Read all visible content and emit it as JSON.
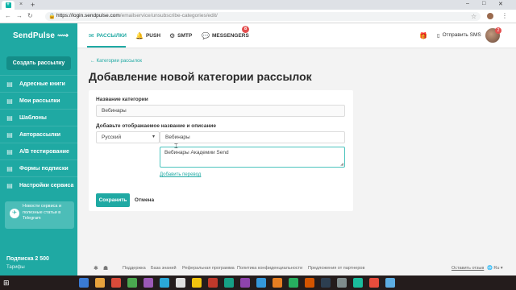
{
  "browser": {
    "tab_icon": "sendpulse-favicon",
    "close_glyph": "×",
    "new_tab_glyph": "+",
    "url_host": "https://login.sendpulse.com",
    "url_path": "/emailservice/unsubscribe-categories/edit/"
  },
  "app": {
    "logo": "SendPulse",
    "logo_mark": "⟿",
    "accent": "#1fa9a3"
  },
  "topnav": {
    "items": [
      {
        "label": "РАССЫЛКИ",
        "icon": "envelope-icon",
        "glyph": "✉",
        "active": true
      },
      {
        "label": "PUSH",
        "icon": "bell-icon",
        "glyph": "🔔",
        "active": false
      },
      {
        "label": "SMTP",
        "icon": "gear-icon",
        "glyph": "⚙",
        "active": false
      },
      {
        "label": "MESSENGERS",
        "icon": "chat-icon",
        "glyph": "💬",
        "active": false
      }
    ],
    "messengers_badge": "8",
    "send_sms": "Отправить SMS",
    "avatar_badge": "2"
  },
  "sidebar": {
    "create_button": "Создать рассылку",
    "items": [
      {
        "label": "Адресные книги",
        "icon": "book-icon",
        "glyph": "▤"
      },
      {
        "label": "Мои рассылки",
        "icon": "mail-list-icon",
        "glyph": "▤"
      },
      {
        "label": "Шаблоны",
        "icon": "template-icon",
        "glyph": "▤"
      },
      {
        "label": "Авторассылки",
        "icon": "automation-icon",
        "glyph": "▤"
      },
      {
        "label": "A/B тестирование",
        "icon": "ab-test-icon",
        "glyph": "▤"
      },
      {
        "label": "Формы подписки",
        "icon": "form-icon",
        "glyph": "▤"
      },
      {
        "label": "Настройки сервиса",
        "icon": "settings-icon",
        "glyph": "▤"
      }
    ],
    "telegram_text": "Новости сервиса и полезные статьи в Telegram",
    "telegram_glyph": "✈",
    "plan": "Подписка 2 500",
    "plan_sub": "Тарифы"
  },
  "main": {
    "breadcrumb": "← Категории рассылок",
    "title": "Добавление новой категории рассылок",
    "category_label": "Название категории",
    "category_value": "Вебинары",
    "display_label": "Добавьте отображаемое название и описание",
    "language_value": "Русский",
    "display_name_value": "Вебинары",
    "description_value": "Вебинары Академии Send",
    "add_translation": "Добавить перевод",
    "save_button": "Сохранить",
    "cancel_button": "Отмена"
  },
  "footer": {
    "links": [
      "Поддержка",
      "База знаний",
      "Реферальная программа",
      "Политика конфиденциальности",
      "Предложения от партнеров"
    ],
    "feedback": "Оставить отзыв",
    "lang": "🌐 Ru ▾"
  }
}
